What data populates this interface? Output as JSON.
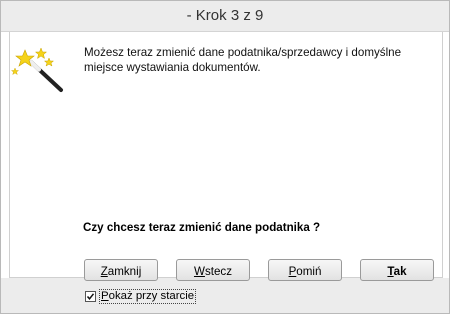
{
  "window": {
    "title": "- Krok 3 z 9"
  },
  "content": {
    "message_line1": "Możesz teraz zmienić dane podatnika/sprzedawcy i domyślne",
    "message_line2": "miejsce wystawiania dokumentów.",
    "question": "Czy chcesz teraz zmienić dane podatnika ?",
    "icon": "magic-wand-icon"
  },
  "buttons": {
    "close": {
      "mnemonic": "Z",
      "rest": "amknij"
    },
    "back": {
      "mnemonic": "W",
      "rest": "stecz"
    },
    "skip": {
      "mnemonic": "P",
      "rest": "omiń"
    },
    "yes": {
      "mnemonic": "T",
      "rest": "ak"
    }
  },
  "footer": {
    "show_on_start": {
      "mnemonic": "P",
      "rest": "okaż przy starcie",
      "checked": true
    }
  }
}
